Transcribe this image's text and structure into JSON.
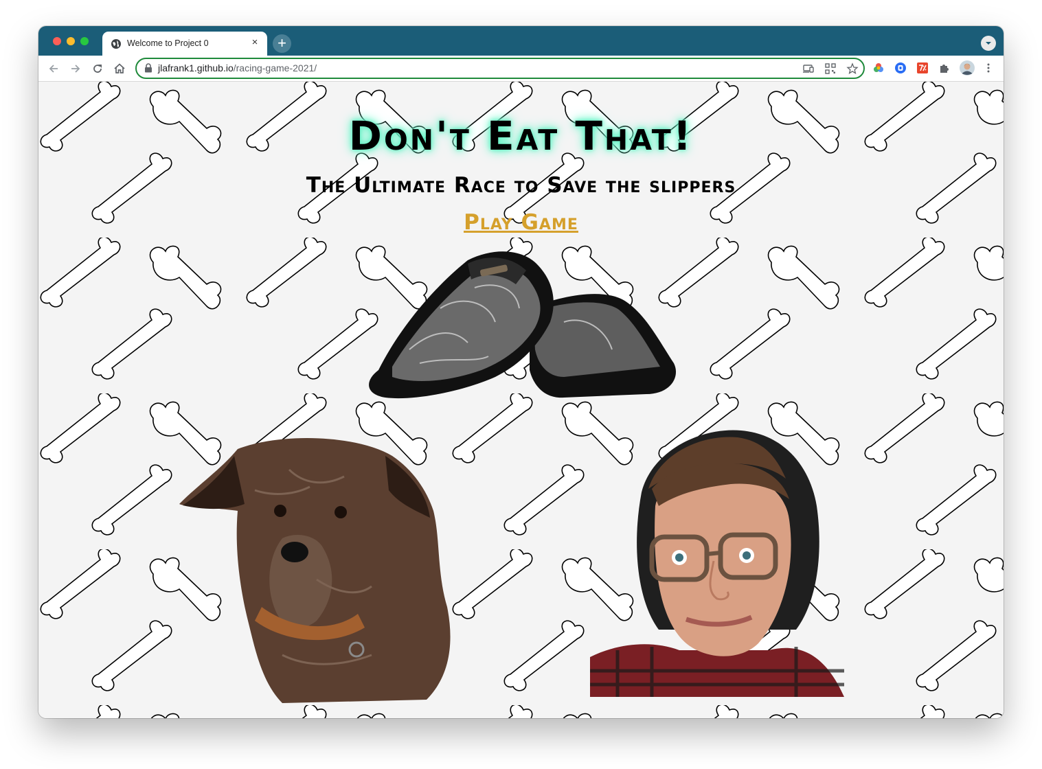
{
  "browser": {
    "tab_title": "Welcome to Project 0",
    "tab_close": "×",
    "new_tab": "+",
    "url_host": "jlafrank1.github.io",
    "url_path": "/racing-game-2021/",
    "accent_color": "#1b5d78",
    "omnibox_focus_color": "#1f8a3b",
    "icons": {
      "back": "arrow-left-icon",
      "forward": "arrow-right-icon",
      "reload": "reload-icon",
      "home": "home-icon",
      "lock": "lock-icon",
      "cast": "cast-icon",
      "qr": "qr-code-icon",
      "bookmark": "star-icon",
      "extensions": "puzzle-icon",
      "menu": "kebab-menu-icon"
    }
  },
  "page": {
    "title": "Don't Eat That!",
    "subtitle": "The Ultimate Race to Save the slippers",
    "play_link": "Play Game",
    "title_glow_color": "#64f0c4",
    "link_color": "#d5a02c",
    "background": "bone pattern",
    "images": [
      "slippers",
      "dog",
      "person with glasses"
    ]
  }
}
